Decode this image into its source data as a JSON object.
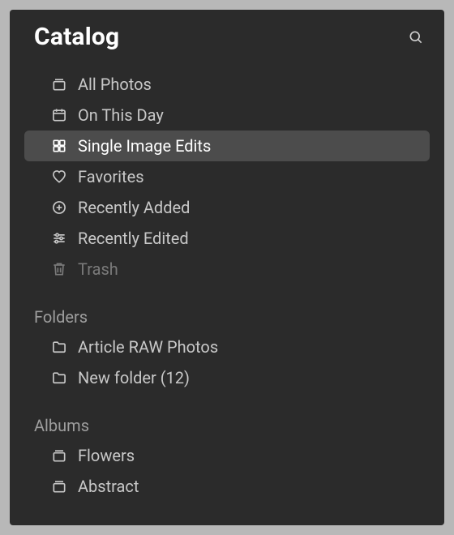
{
  "header": {
    "title": "Catalog"
  },
  "catalog": {
    "items": [
      {
        "label": "All Photos"
      },
      {
        "label": "On This Day"
      },
      {
        "label": "Single Image Edits"
      },
      {
        "label": "Favorites"
      },
      {
        "label": "Recently Added"
      },
      {
        "label": "Recently Edited"
      },
      {
        "label": "Trash"
      }
    ]
  },
  "sections": {
    "folders_label": "Folders",
    "albums_label": "Albums"
  },
  "folders": {
    "items": [
      {
        "label": "Article RAW Photos"
      },
      {
        "label": "New folder (12)"
      }
    ]
  },
  "albums": {
    "items": [
      {
        "label": "Flowers"
      },
      {
        "label": "Abstract"
      }
    ]
  }
}
